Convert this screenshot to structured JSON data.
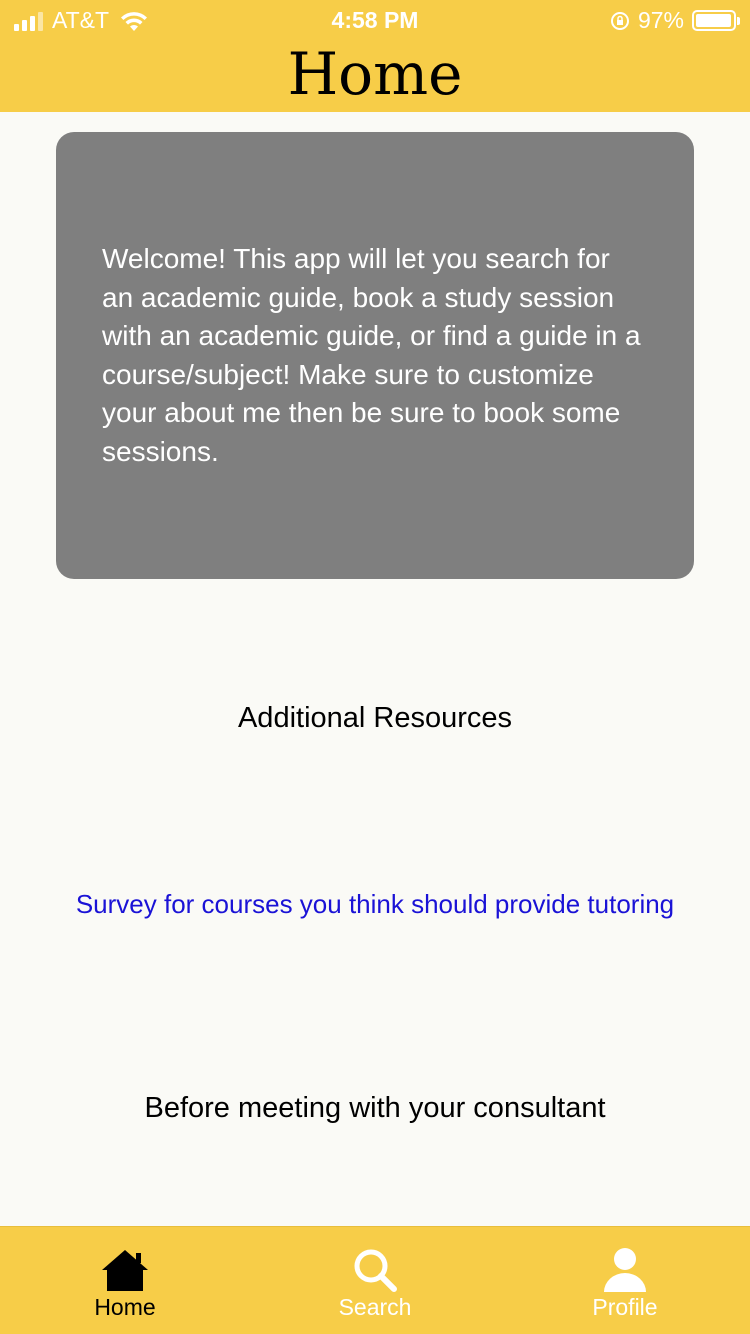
{
  "status_bar": {
    "carrier": "AT&T",
    "time": "4:58 PM",
    "battery": "97%",
    "battery_level": 0.97
  },
  "header": {
    "title": "Home"
  },
  "welcome": {
    "text": "Welcome!  This app will let you search for an academic guide, book a study session with an academic guide, or find a guide in a course/subject! Make sure to customize your about me then be sure to book some sessions."
  },
  "resources": {
    "heading": "Additional Resources",
    "survey_link": "Survey for courses you think should provide tutoring",
    "consultant_link": "Before meeting with your consultant"
  },
  "tab_bar": {
    "tabs": [
      {
        "label": "Home",
        "icon": "home-icon",
        "active": true
      },
      {
        "label": "Search",
        "icon": "search-icon",
        "active": false
      },
      {
        "label": "Profile",
        "icon": "person-icon",
        "active": false
      }
    ]
  },
  "colors": {
    "accent": "#f7cd48",
    "card": "#7f7f7f",
    "link": "#1a12d6",
    "background": "#fafaf6"
  }
}
